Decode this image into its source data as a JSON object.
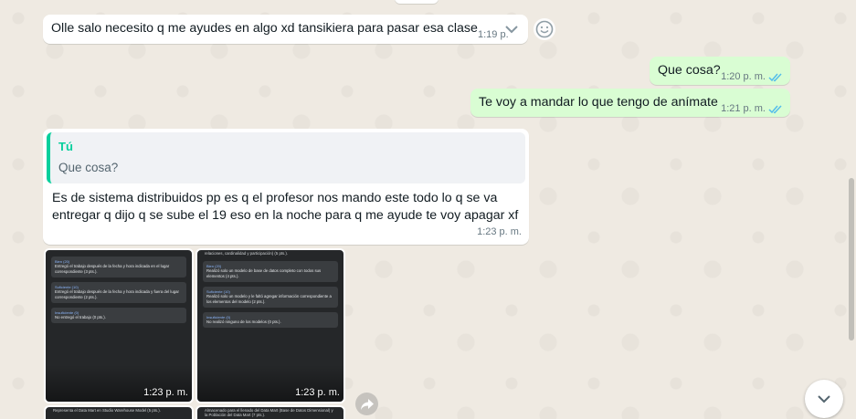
{
  "messages": {
    "m1": {
      "text": "Olle salo necesito q me ayudes en algo  xd tansikiera para pasar esa clase",
      "time": "1:19 p."
    },
    "m2": {
      "text": "Que cosa?",
      "time": "1:20 p. m."
    },
    "m3": {
      "text": "Te voy a mandar lo que tengo de anímate",
      "time": "1:21 p. m."
    },
    "m4": {
      "quote_author": "Tú",
      "quote_text": "Que cosa?",
      "text": "Es de sistema distribuidos pp es q el profesor nos mando este todo lo q se va\nentregar q dijo q se sube el 19 eso en la noche para q me ayude te voy apagar xf",
      "time": "1:23 p. m."
    }
  },
  "images": {
    "tile1": {
      "time": "1:23 p. m.",
      "cards": [
        {
          "level": "Bien (20)",
          "desc": "Entregó el trabajo después de la fecha y hora indicada en el lugar correspondiente (3 pts.)."
        },
        {
          "level": "Suficiente (10)",
          "desc": "Entregó el trabajo después de la fecha y hora indicada y fuera del lugar correspondiente (2 pts.)."
        },
        {
          "level": "Insuficiente (0)",
          "desc": "No entregó el trabajo (0 pts.)."
        }
      ]
    },
    "tile2": {
      "time": "1:23 p. m.",
      "top_partial": "relaciones, cardinalidad y participación) (5 pts.).",
      "cards": [
        {
          "level": "Bien (20)",
          "desc": "Realizó solo un modelo de base de datos completo con todos sus elementos (4 pts.)."
        },
        {
          "level": "Suficiente (10)",
          "desc": "Realizó solo un modelo y le faltó agregar información correspondiente a los elementos del modelo (2 pts.)."
        },
        {
          "level": "Insuficiente (0)",
          "desc": "No realizó ninguno de los modelos (0 pts.)."
        }
      ]
    },
    "tile3": {
      "partial": "Representa el Data Mart en Studio Warehouse Model (5 pts.)."
    },
    "tile4": {
      "partial": "Almacenado para el llenado del Data Mart (Base de Datos Dimensional) y la Población del Data Mart (7 pts.)."
    }
  },
  "icons": {
    "chevron": "chevron-down-icon",
    "emoji": "emoji-icon",
    "ticks": "double-check-icon",
    "forward": "forward-icon",
    "scroll_down": "chevron-down-icon"
  },
  "colors": {
    "incoming": "#ffffff",
    "outgoing": "#d9fdd3",
    "quote_accent": "#06cf9c",
    "read_ticks": "#53bdeb",
    "background": "#efeae2"
  }
}
